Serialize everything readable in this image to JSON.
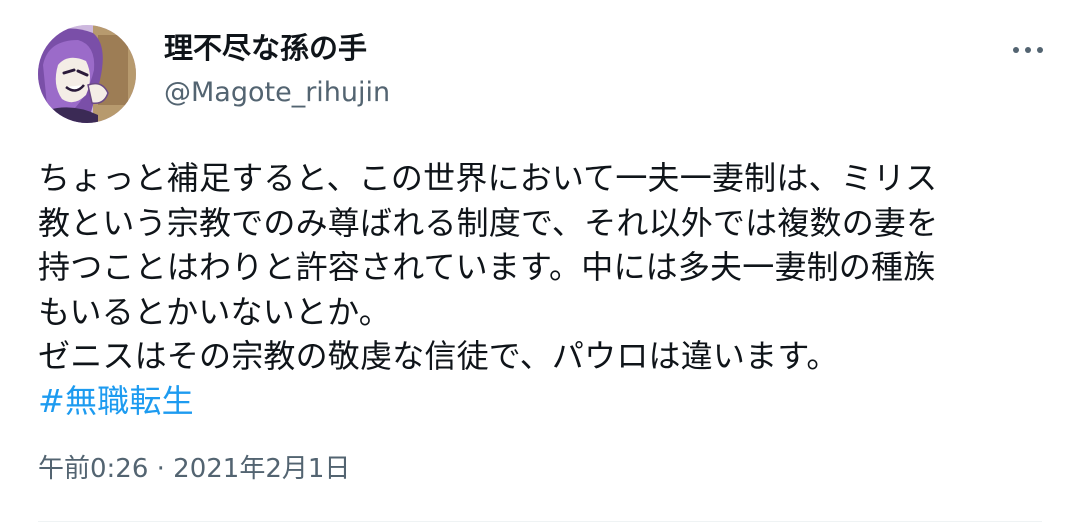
{
  "user": {
    "display_name": "理不尽な孫の手",
    "handle": "@Magote_rihujin"
  },
  "more_icon": "more-horizontal-icon",
  "tweet": {
    "lines": [
      "ちょっと補足すると、この世界において一夫一妻制は、ミリス",
      "教という宗教でのみ尊ばれる制度で、それ以外では複数の妻を",
      "持つことはわりと許容されています。中には多夫一妻制の種族",
      "もいるとかいないとか。",
      "ゼニスはその宗教の敬虔な信徒で、パウロは違います。"
    ],
    "hashtag": "#無職転生"
  },
  "timestamp": "午前0:26 · 2021年2月1日",
  "colors": {
    "text": "#0f1419",
    "secondary": "#536471",
    "link": "#1d9bf0"
  }
}
